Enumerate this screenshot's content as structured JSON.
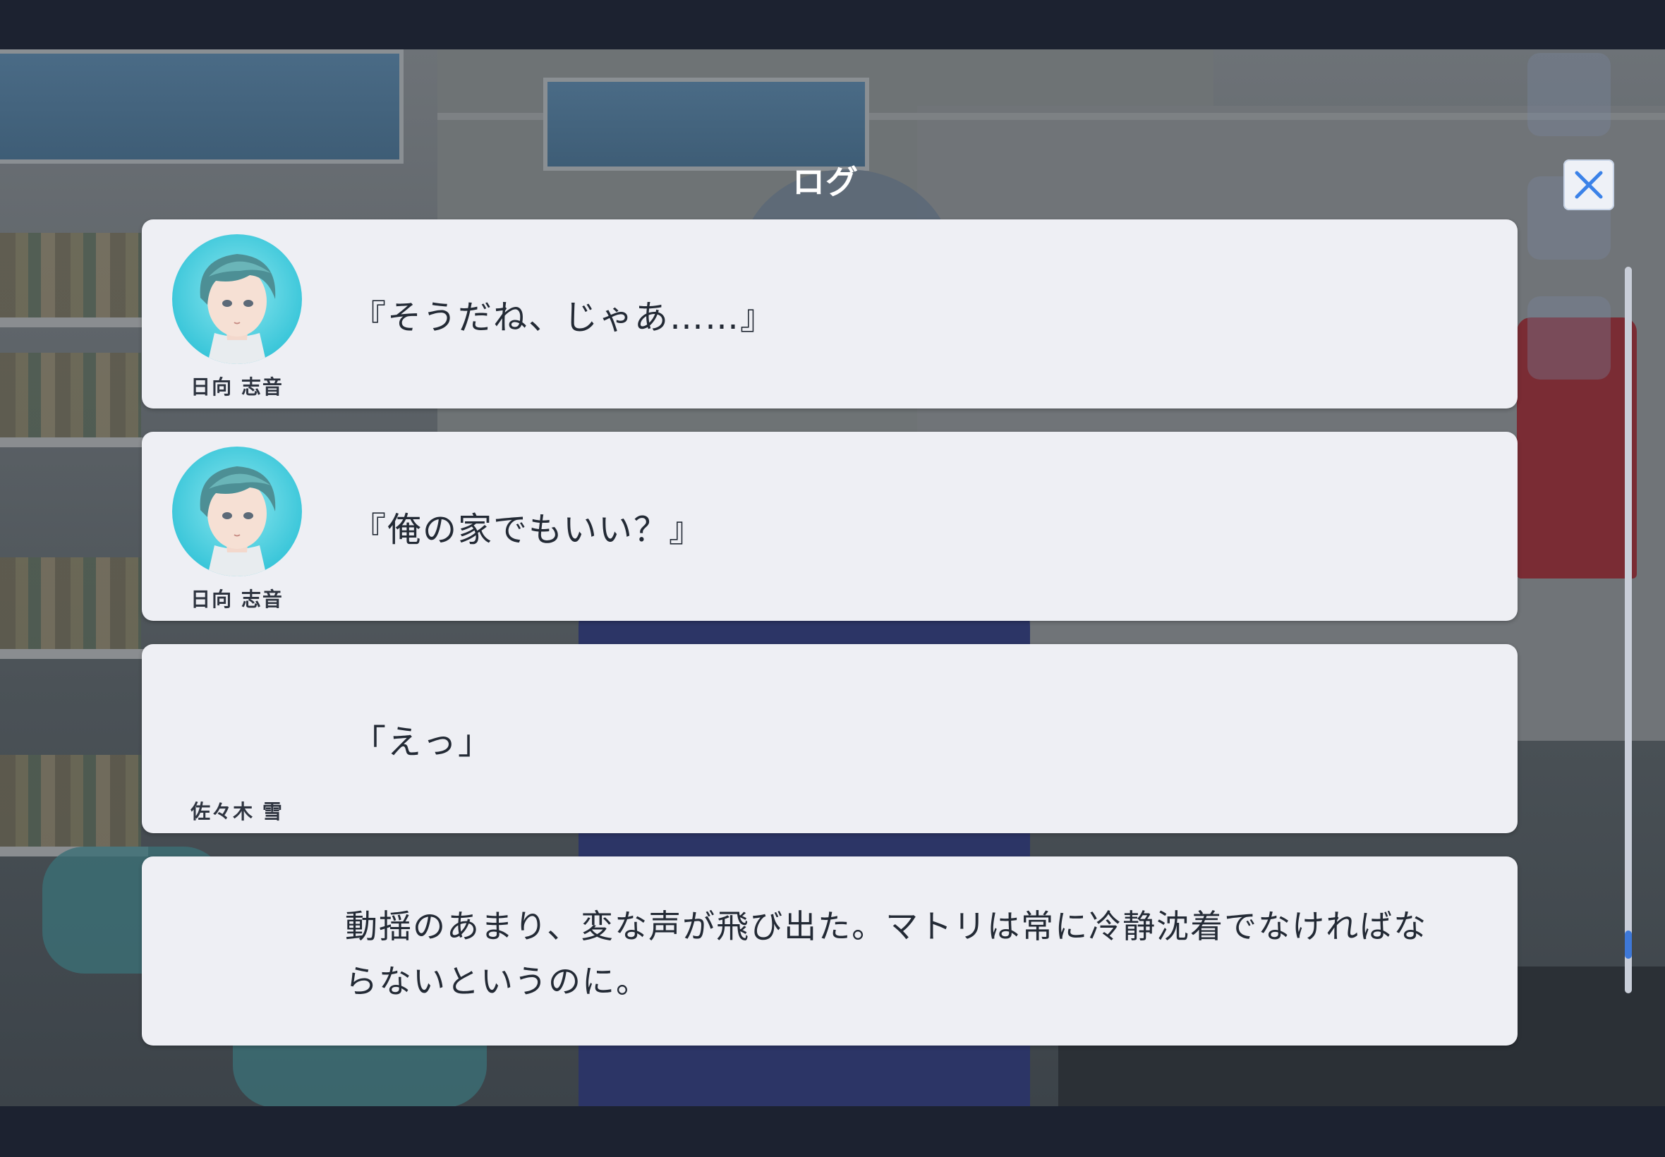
{
  "header": {
    "title": "ログ"
  },
  "log_entries": [
    {
      "speaker": "日向 志音",
      "text": "『そうだね、じゃあ……』",
      "has_avatar": true
    },
    {
      "speaker": "日向 志音",
      "text": "『俺の家でもいい？』",
      "has_avatar": true
    },
    {
      "speaker": "佐々木 雪",
      "text": "「えっ」",
      "has_avatar": false
    },
    {
      "speaker": "",
      "text": "動揺のあまり、変な声が飛び出た。マトリは常に冷静沈着でなければならないというのに。",
      "has_avatar": false
    }
  ],
  "scroll": {
    "position_fraction": 0.95
  },
  "icons": {
    "close": "close-icon",
    "avatar": "character-avatar"
  },
  "colors": {
    "card": "#eeeff4",
    "accent": "#3e78d8",
    "text": "#232a35"
  }
}
